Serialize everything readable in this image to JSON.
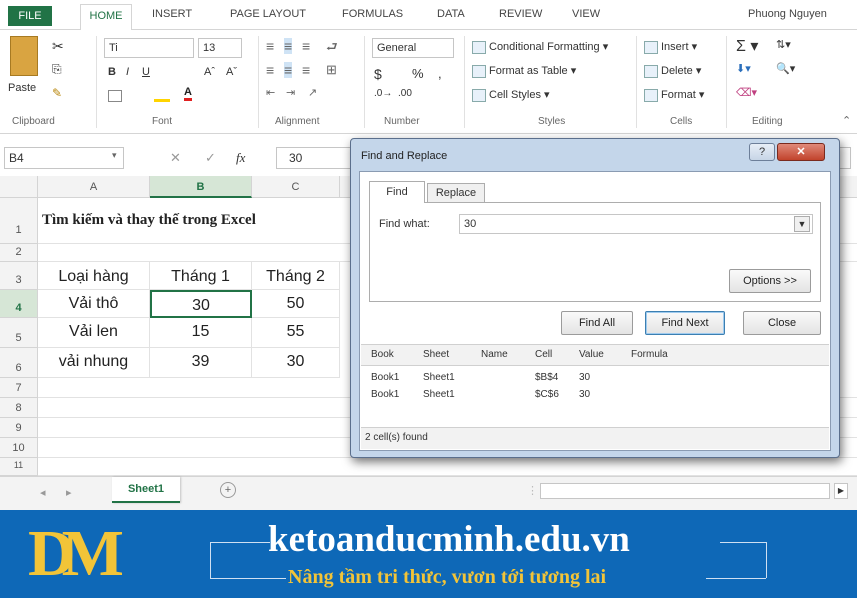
{
  "ribbon": {
    "tabs": [
      "FILE",
      "HOME",
      "INSERT",
      "PAGE LAYOUT",
      "FORMULAS",
      "DATA",
      "REVIEW",
      "VIEW"
    ],
    "user": "Phuong Nguyen",
    "paste": "Paste",
    "font_name": "Ti",
    "font_size": "13",
    "number_format": "General",
    "conditional_formatting": "Conditional Formatting",
    "format_as_table": "Format as Table",
    "cell_styles": "Cell Styles",
    "insert": "Insert",
    "delete": "Delete",
    "format": "Format",
    "groups": {
      "clipboard": "Clipboard",
      "font": "Font",
      "alignment": "Alignment",
      "number": "Number",
      "styles": "Styles",
      "cells": "Cells",
      "editing": "Editing"
    }
  },
  "formula_bar": {
    "name_box": "B4",
    "fx": "fx",
    "value": "30"
  },
  "sheet": {
    "columns": [
      "A",
      "B",
      "C"
    ],
    "rows": [
      "1",
      "2",
      "3",
      "4",
      "5",
      "6",
      "7",
      "8",
      "9",
      "10",
      "11"
    ],
    "title": "Tìm kiếm và thay thế trong Excel",
    "header": [
      "Loại hàng",
      "Tháng 1",
      "Tháng 2"
    ],
    "data": [
      [
        "Vải thô",
        "30",
        "50"
      ],
      [
        "Vải len",
        "15",
        "55"
      ],
      [
        "vải nhung",
        "39",
        "30"
      ]
    ],
    "tab": "Sheet1"
  },
  "dialog": {
    "title": "Find and Replace",
    "tabs": [
      "Find",
      "Replace"
    ],
    "find_label": "Find what:",
    "find_value": "30",
    "options": "Options >>",
    "find_all": "Find All",
    "find_next": "Find Next",
    "close": "Close",
    "results_headers": [
      "Book",
      "Sheet",
      "Name",
      "Cell",
      "Value",
      "Formula"
    ],
    "results": [
      [
        "Book1",
        "Sheet1",
        "",
        "$B$4",
        "30",
        ""
      ],
      [
        "Book1",
        "Sheet1",
        "",
        "$C$6",
        "30",
        ""
      ]
    ],
    "status": "2 cell(s) found"
  },
  "banner": {
    "site": "ketoanducminh.edu.vn",
    "slogan": "Nâng tầm tri thức, vươn tới tương lai",
    "logo_letters": "DM"
  }
}
